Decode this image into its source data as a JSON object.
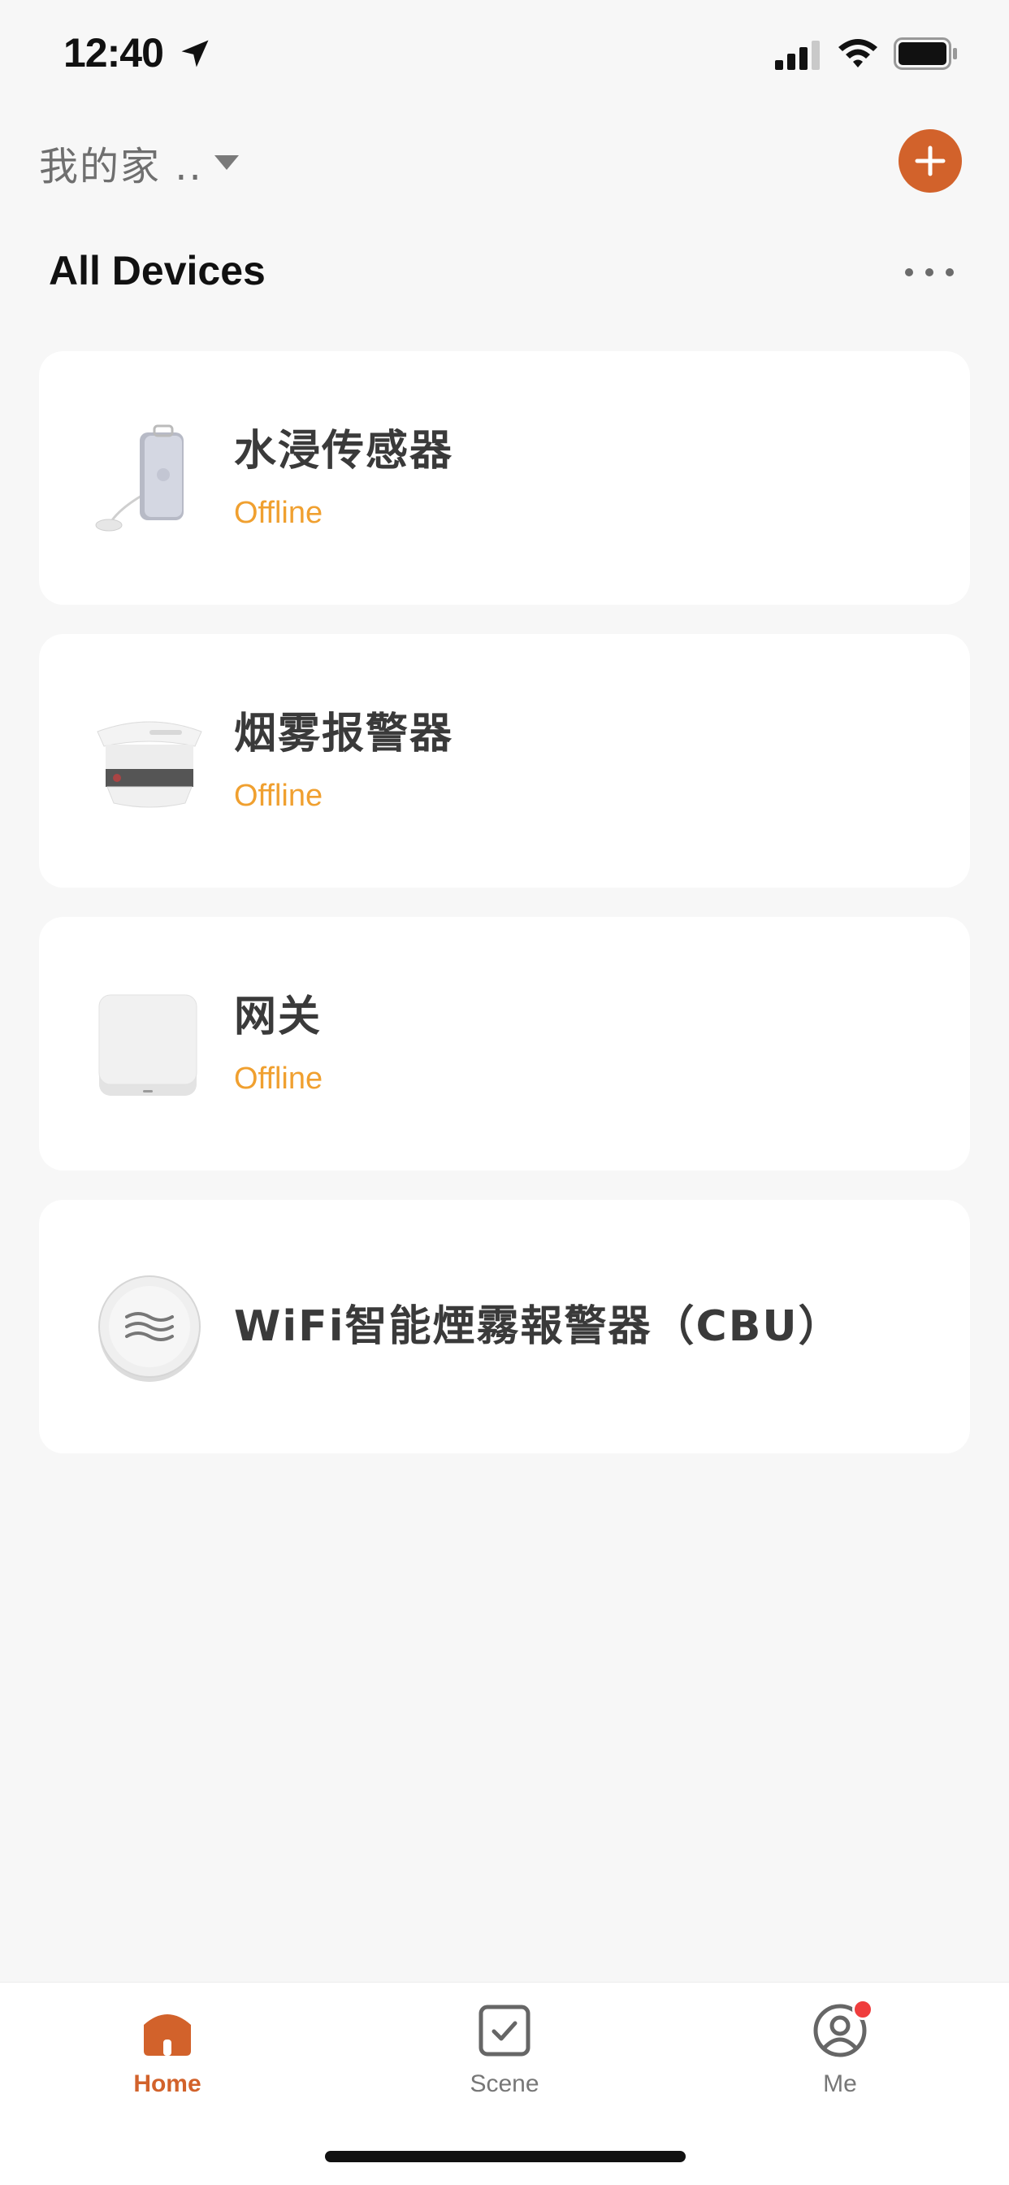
{
  "status_bar": {
    "time": "12:40"
  },
  "header": {
    "home_name": "我的家 ..",
    "section_title": "All Devices"
  },
  "devices": [
    {
      "name": "水浸传感器",
      "status": "Offline",
      "icon": "water-leak-sensor-icon"
    },
    {
      "name": "烟雾报警器",
      "status": "Offline",
      "icon": "smoke-detector-icon"
    },
    {
      "name": "网关",
      "status": "Offline",
      "icon": "gateway-icon"
    },
    {
      "name": "WiFi智能煙霧報警器（CBU）",
      "status": "",
      "icon": "wifi-smoke-alarm-icon"
    }
  ],
  "tabs": [
    {
      "label": "Home",
      "active": true,
      "icon": "home-icon"
    },
    {
      "label": "Scene",
      "active": false,
      "icon": "scene-checkbox-icon"
    },
    {
      "label": "Me",
      "active": false,
      "icon": "profile-icon",
      "badge": true
    }
  ],
  "colors": {
    "accent": "#d2622b",
    "offline": "#f0a030",
    "background": "#f7f7f7",
    "badge": "#ef3d3d"
  }
}
